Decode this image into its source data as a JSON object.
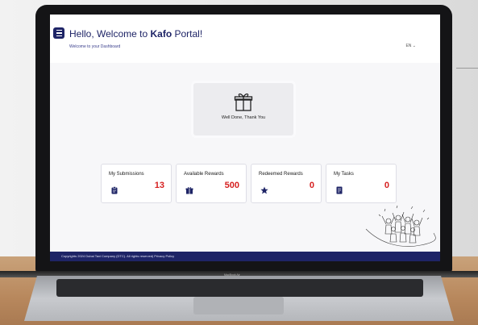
{
  "header": {
    "greeting_prefix": "Hello, Welcome to ",
    "brand": "Kafo",
    "greeting_suffix": " Portal!",
    "subtitle": "Welcome to your Dashboard",
    "language": "EN ⌄"
  },
  "thanks_panel": {
    "message": "Well Done, Thank You",
    "icon": "gift-icon"
  },
  "cards": [
    {
      "label": "My Submissions",
      "value": "13",
      "icon": "clipboard-icon"
    },
    {
      "label": "Available Rewards",
      "value": "500",
      "icon": "gift-icon"
    },
    {
      "label": "Redeemed Rewards",
      "value": "0",
      "icon": "star-icon"
    },
    {
      "label": "My Tasks",
      "value": "0",
      "icon": "document-icon"
    }
  ],
  "footer": {
    "copyright": "Copyrights 2024 Dubai Taxi Company (DTC). All rights reserved| Privacy Policy"
  },
  "laptop": {
    "model_label": "MacBook Air"
  },
  "colors": {
    "brand_navy": "#1e2466",
    "value_red": "#d62020"
  }
}
